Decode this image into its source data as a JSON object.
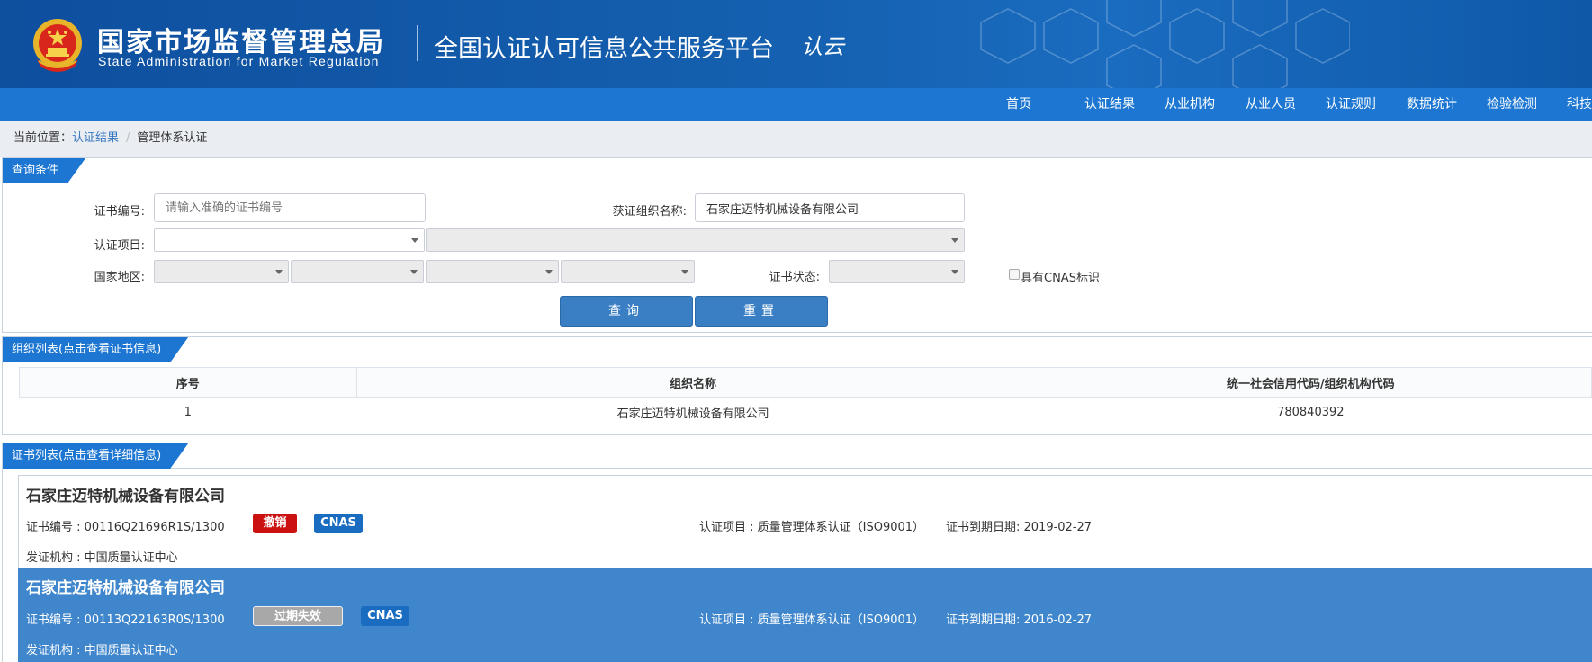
{
  "header": {
    "org_name_cn": "国家市场监督管理总局",
    "org_name_en": "State Administration  for  Market Regulation",
    "platform_title": "全国认证认可信息公共服务平台",
    "logo_text": "认云"
  },
  "nav": {
    "items": [
      "首页",
      "认证结果",
      "从业机构",
      "从业人员",
      "认证规则",
      "数据统计",
      "检验检测",
      "科技"
    ]
  },
  "breadcrumb": {
    "prefix": "当前位置：",
    "link": "认证结果",
    "separator": "/",
    "current": "管理体系认证"
  },
  "query": {
    "title": "查询条件",
    "cert_no_label": "证书编号:",
    "cert_no_placeholder": "请输入准确的证书编号",
    "org_name_label": "获证组织名称:",
    "org_name_value": "石家庄迈特机械设备有限公司",
    "cert_project_label": "认证项目:",
    "region_label": "国家地区:",
    "cert_status_label": "证书状态:",
    "cnas_label": "具有CNAS标识",
    "search_btn": "查询",
    "reset_btn": "重置"
  },
  "org_list": {
    "title": "组织列表(点击查看证书信息)",
    "columns": [
      "序号",
      "组织名称",
      "统一社会信用代码/组织机构代码"
    ],
    "rows": [
      {
        "index": "1",
        "name": "石家庄迈特机械设备有限公司",
        "code": "780840392"
      }
    ]
  },
  "cert_list": {
    "title": "证书列表(点击查看详细信息)",
    "items": [
      {
        "org": "石家庄迈特机械设备有限公司",
        "cert_no": "证书编号 : 00116Q21696R1S/1300",
        "status": "撤销",
        "cnas": "CNAS",
        "project": "认证项目 : 质量管理体系认证（ISO9001）",
        "expiry": "证书到期日期: 2019-02-27",
        "issuer": "发证机构 : 中国质量认证中心"
      },
      {
        "org": "石家庄迈特机械设备有限公司",
        "cert_no": "证书编号 : 00113Q22163R0S/1300",
        "status": "过期失效",
        "cnas": "CNAS",
        "project": "认证项目 : 质量管理体系认证（ISO9001）",
        "expiry": "证书到期日期: 2016-02-27",
        "issuer": "发证机构 : 中国质量认证中心"
      }
    ]
  },
  "colors": {
    "header_blue": "#0e4f9e",
    "nav_blue": "#1d77d2",
    "revoked_red": "#cc1111",
    "selected_card": "#3f86cc"
  }
}
